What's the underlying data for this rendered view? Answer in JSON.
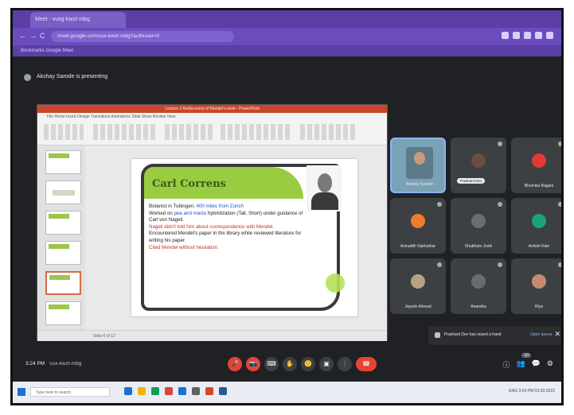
{
  "browser": {
    "tab_title": "Meet - vuxg-kwzt-mbg",
    "url": "meet.google.com/vux-kwzt-mbg?authuser=0",
    "bookmarks": "Bookmarks  Google Meet"
  },
  "meet": {
    "title": "Akshay Sarode is presenting",
    "time": "3:24 PM",
    "meeting_code": "vux-kwzt-mbg"
  },
  "ppt": {
    "title_bar": "Lecture 3 Rediscovery of Mendel's work - PowerPoint",
    "ribbon_tabs": "File  Home  Insert  Design  Transitions  Animations  Slide Show  Review  View",
    "status": "Slide 6 of 12"
  },
  "slide": {
    "heading": "Carl Correns",
    "lines": [
      {
        "t1": "Botanist in Tubingen, ",
        "t2": "400 miles from Zurich",
        "t3": ""
      },
      {
        "t1": "Worked on ",
        "t2": "pea and maize",
        "t3": " hybridization (Tall, Short) under guidance of Carl von Nageli."
      }
    ],
    "red_line": "Nageli didn't told him about correspondence with Mendel.",
    "line4": "Encountered Mendel's paper in the library while reviewed literature for writing his paper.",
    "red_line2": "Cited Mendel without hesitation."
  },
  "participants": [
    {
      "name": "Akshay Sarode",
      "color": "#7aa2b6"
    },
    {
      "name": "Prashant Dev",
      "color": "#6d4c41"
    },
    {
      "name": "Bhumika Bagani",
      "color": "#e53935"
    },
    {
      "name": "Aniruddh Sakharkar",
      "color": "#ef7b2d"
    },
    {
      "name": "Shubham Joshi",
      "color": "#6d6d6d"
    },
    {
      "name": "Ashish Kale",
      "color": "#1aa37a"
    },
    {
      "name": "Jayesh Ahirwal",
      "color": "#b8a182"
    },
    {
      "name": "Anamika",
      "color": "#6b6b6b"
    },
    {
      "name": "Riya",
      "color": "#c58a72"
    }
  ],
  "toast": {
    "text": "Prashant Dev has raised a hand",
    "action": "Open queue",
    "close": "✕"
  },
  "controls": {
    "icons": [
      "🎤",
      "📷",
      "⌨",
      "✋",
      "🙂",
      "▣",
      "⋮"
    ],
    "end": "☎",
    "right": [
      "ⓘ",
      "👥",
      "💬",
      "⚙"
    ],
    "people_count": "10"
  },
  "taskbar": {
    "search": "Type here to search",
    "tray": "ENG  3:24 PM  03-03-2022",
    "app_colors": [
      "#1d6fd1",
      "#f4b400",
      "#0f9d58",
      "#db4437",
      "#1d6fd1",
      "#5f6368",
      "#d24726",
      "#2b579a"
    ]
  }
}
